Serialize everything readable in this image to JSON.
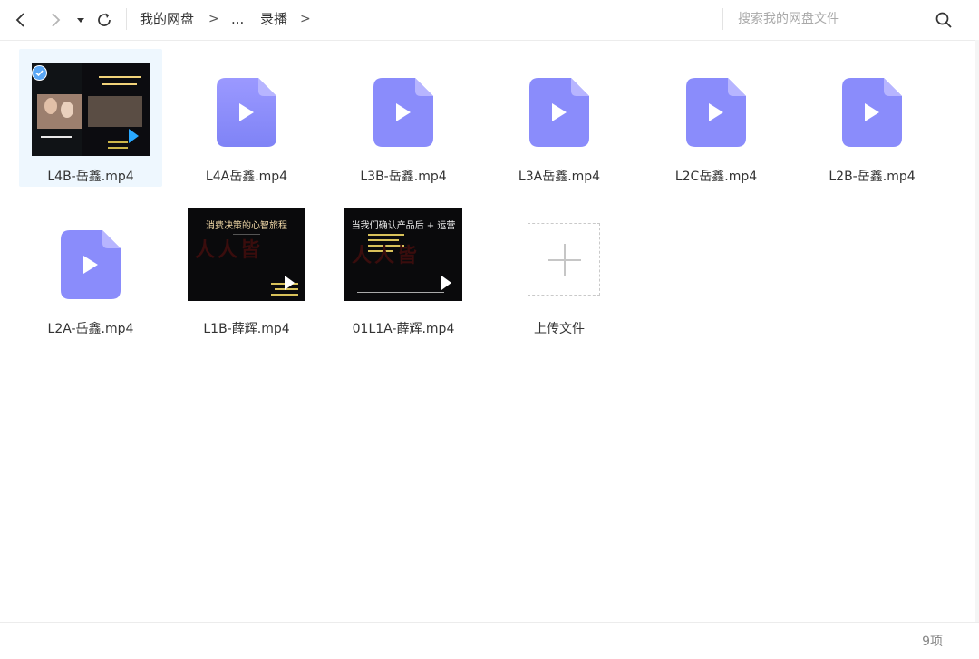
{
  "toolbar": {
    "breadcrumb": [
      "我的网盘",
      "...",
      "录播"
    ],
    "crumb_sep": ">",
    "search_placeholder": "搜索我的网盘文件"
  },
  "files": [
    {
      "name": "L4B-岳鑫.mp4",
      "type": "video-thumb",
      "selected": true
    },
    {
      "name": "L4A岳鑫.mp4",
      "type": "video-icon"
    },
    {
      "name": "L3B-岳鑫.mp4",
      "type": "video-icon"
    },
    {
      "name": "L3A岳鑫.mp4",
      "type": "video-icon"
    },
    {
      "name": "L2C岳鑫.mp4",
      "type": "video-icon"
    },
    {
      "name": "L2B-岳鑫.mp4",
      "type": "video-icon"
    },
    {
      "name": "L2A-岳鑫.mp4",
      "type": "video-icon"
    },
    {
      "name": "L1B-薛辉.mp4",
      "type": "video-thumb",
      "thumb_title": "消费决策的心智旅程"
    },
    {
      "name": "01L1A-薛辉.mp4",
      "type": "video-thumb",
      "thumb_title": "当我们确认产品后 + 运营"
    },
    {
      "name": "上传文件",
      "type": "upload"
    }
  ],
  "status": {
    "item_count": "9项"
  },
  "colors": {
    "accent": "#5aa7f5",
    "icon_purple": "#8a8cfb",
    "selected_bg": "#eef7fe"
  }
}
